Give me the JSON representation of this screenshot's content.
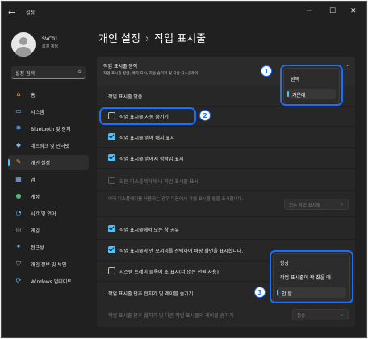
{
  "window": {
    "title": "설정",
    "back_icon": "back-arrow-icon",
    "controls": [
      "─",
      "☐",
      "✕"
    ]
  },
  "user": {
    "name": "SVC01",
    "type": "로컬 계정"
  },
  "search": {
    "placeholder": "설정 검색",
    "icon": "search-icon"
  },
  "sidebar": {
    "items": [
      {
        "label": "홈",
        "icon": "home-icon",
        "glyph": "⌂",
        "color": "#d9a441"
      },
      {
        "label": "시스템",
        "icon": "system-icon",
        "glyph": "▭",
        "color": "#4cc2ff"
      },
      {
        "label": "Bluetooth 및 장치",
        "icon": "bluetooth-icon",
        "glyph": "✱",
        "color": "#4aa0ff"
      },
      {
        "label": "네트워크 및 인터넷",
        "icon": "network-icon",
        "glyph": "◆",
        "color": "#7fb3e0"
      },
      {
        "label": "개인 설정",
        "icon": "brush-icon",
        "glyph": "✎",
        "color": "#e0a060",
        "selected": true
      },
      {
        "label": "앱",
        "icon": "apps-icon",
        "glyph": "▦",
        "color": "#8ab4f8"
      },
      {
        "label": "계정",
        "icon": "account-icon",
        "glyph": "●",
        "color": "#4cb870"
      },
      {
        "label": "시간 및 언어",
        "icon": "time-language-icon",
        "glyph": "◔",
        "color": "#4cc2ff"
      },
      {
        "label": "게임",
        "icon": "gaming-icon",
        "glyph": "◎",
        "color": "#9aa0a6"
      },
      {
        "label": "접근성",
        "icon": "accessibility-icon",
        "glyph": "✦",
        "color": "#4cc2ff"
      },
      {
        "label": "개인 정보 및 보안",
        "icon": "shield-icon",
        "glyph": "⛉",
        "color": "#9aa0a6"
      },
      {
        "label": "Windows 업데이트",
        "icon": "update-icon",
        "glyph": "⟳",
        "color": "#4cc2ff"
      }
    ]
  },
  "breadcrumb": {
    "parent": "개인 설정",
    "separator": "›",
    "current": "작업 표시줄"
  },
  "section": {
    "title": "작업 표시줄 동작",
    "subtitle": "작업 표시줄 정렬, 배지 표시, 자동 숨기기 및 다중 디스플레이",
    "chevron": "chevron-up-icon"
  },
  "settings": {
    "alignment_label": "작업 표시줄 맞춤",
    "auto_hide_label": "작업 표시줄 자동 숨기기",
    "show_badges_label": "작업 표시줄 앱에 배지 표시",
    "show_flashing_label": "작업 표시줄 앱에서 깜박임 표시",
    "all_displays_label": "모든 디스플레이에 내 작업 표시줄 표시",
    "multi_display_label": "여러 디스플레이를 사용하는 경우 다음에서 작업 표시줄 앱을 표시합니다.",
    "multi_display_value": "모든 작업 표시줄",
    "share_window_label": "작업 표시줄에서 모든 창 공유",
    "far_corner_label": "작업 표시줄의 맨 모서리를 선택하여 바탕 화면을 표시합니다.",
    "tray_label": "시스템 트레이 클록에 초 표시(더 많은 전원 사용)",
    "hide_labels_label": "작업 표시줄 단추 합치기 및 레이블 숨기기",
    "other_hide_labels_label": "작업 표시줄 단추 합치기 및 다른 작업 표시줄의 레이블 숨기기",
    "other_hide_labels_value": "항상"
  },
  "alignment_popup": {
    "options": [
      "왼쪽",
      "가운데"
    ],
    "selected": "가운데"
  },
  "combine_popup": {
    "options": [
      "항상",
      "작업 표시줄이 꽉 찼을 때",
      "안 함"
    ],
    "selected": "안 함"
  },
  "annotations": {
    "badge_1": "1",
    "badge_2": "2",
    "badge_3": "3",
    "highlight_color": "#1a6fff"
  }
}
